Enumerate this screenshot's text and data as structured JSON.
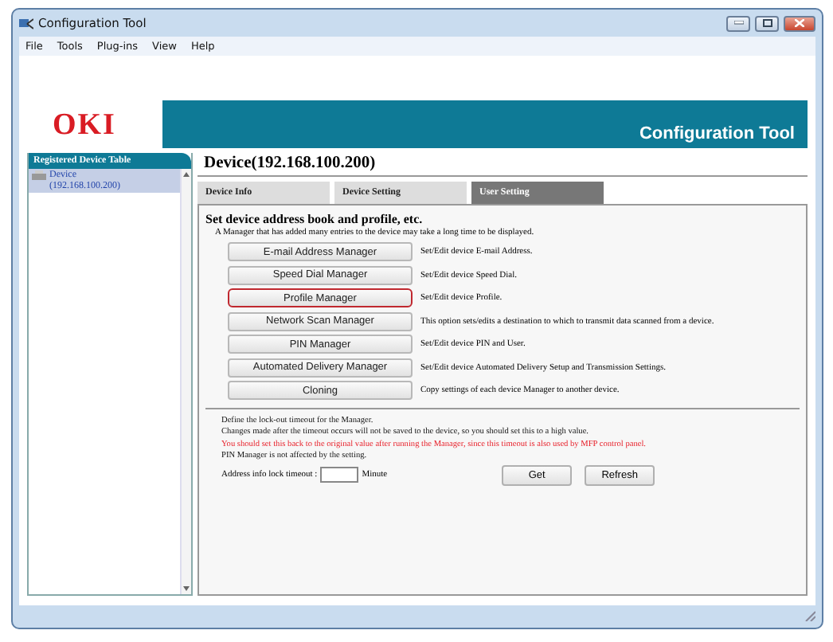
{
  "window": {
    "title": "Configuration Tool"
  },
  "menu": [
    "File",
    "Tools",
    "Plug-ins",
    "View",
    "Help"
  ],
  "header": {
    "logo": "OKI",
    "title": "Configuration Tool"
  },
  "sidebar": {
    "heading": "Registered Device Table",
    "items": [
      {
        "label": "Device",
        "sublabel": "(192.168.100.200)",
        "selected": true
      }
    ]
  },
  "main": {
    "heading": "Device(192.168.100.200)",
    "tabs": [
      {
        "label": "Device Info",
        "selected": false
      },
      {
        "label": "Device Setting",
        "selected": false
      },
      {
        "label": "User Setting",
        "selected": true
      }
    ],
    "section_title": "Set device address book and profile, etc.",
    "note": "A Manager that has added many entries to the device may take a long time to be displayed.",
    "managers": [
      {
        "label": "E-mail Address Manager",
        "description": "Set/Edit device E-mail Address.",
        "selected": false
      },
      {
        "label": "Speed Dial Manager",
        "description": "Set/Edit device Speed Dial.",
        "selected": false
      },
      {
        "label": "Profile Manager",
        "description": "Set/Edit device Profile.",
        "selected": true
      },
      {
        "label": "Network Scan Manager",
        "description": "This option sets/edits a destination to which to transmit data scanned from a device.",
        "selected": false
      },
      {
        "label": "PIN Manager",
        "description": "Set/Edit device PIN and User.",
        "selected": false
      },
      {
        "label": "Automated Delivery Manager",
        "description": "Set/Edit device Automated Delivery Setup and Transmission Settings.",
        "selected": false
      },
      {
        "label": "Cloning",
        "description": "Copy settings of each device Manager to another device.",
        "selected": false
      }
    ],
    "lockout": {
      "lines": [
        {
          "kind": "normal",
          "text": "Define the lock-out timeout for the Manager."
        },
        {
          "kind": "normal",
          "text": "Changes made after the timeout occurs will not be saved to the device, so you should set this to a high value."
        },
        {
          "kind": "warning",
          "text": "You should set this back to the original value after running the Manager, since this timeout is also used by MFP control panel."
        },
        {
          "kind": "normal",
          "text": "PIN Manager is not affected by the setting."
        }
      ],
      "field_label": "Address info lock timeout :",
      "unit": "Minute",
      "buttons": [
        "Get",
        "Refresh"
      ]
    }
  }
}
